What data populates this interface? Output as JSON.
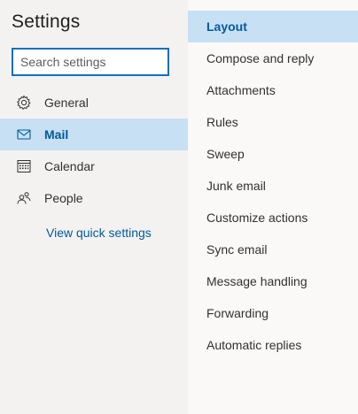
{
  "header": {
    "title": "Settings"
  },
  "search": {
    "placeholder": "Search settings",
    "value": ""
  },
  "nav": {
    "items": [
      {
        "label": "General",
        "icon": "gear-icon",
        "active": false
      },
      {
        "label": "Mail",
        "icon": "mail-icon",
        "active": true
      },
      {
        "label": "Calendar",
        "icon": "calendar-icon",
        "active": false
      },
      {
        "label": "People",
        "icon": "people-icon",
        "active": false
      }
    ],
    "quick_link": "View quick settings"
  },
  "mail_settings": {
    "items": [
      {
        "label": "Layout",
        "active": true
      },
      {
        "label": "Compose and reply",
        "active": false
      },
      {
        "label": "Attachments",
        "active": false
      },
      {
        "label": "Rules",
        "active": false
      },
      {
        "label": "Sweep",
        "active": false
      },
      {
        "label": "Junk email",
        "active": false
      },
      {
        "label": "Customize actions",
        "active": false
      },
      {
        "label": "Sync email",
        "active": false
      },
      {
        "label": "Message handling",
        "active": false
      },
      {
        "label": "Forwarding",
        "active": false
      },
      {
        "label": "Automatic replies",
        "active": false
      }
    ]
  },
  "colors": {
    "accent": "#005a9e",
    "selected_bg": "#c7e0f4",
    "focus_border": "#106ebe"
  }
}
